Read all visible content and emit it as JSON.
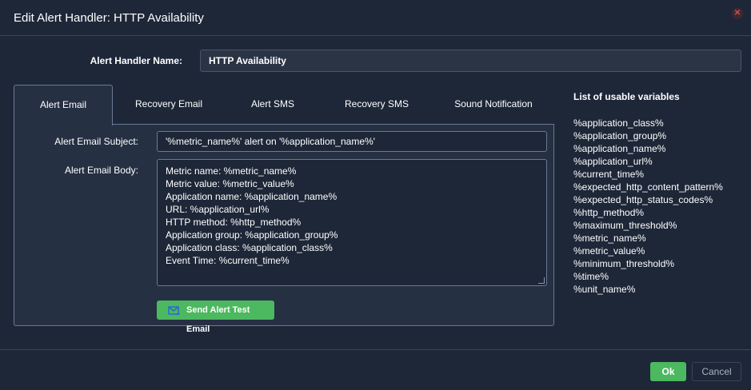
{
  "dialog": {
    "title": "Edit Alert Handler: HTTP Availability",
    "close_icon": "close-icon"
  },
  "handler_name": {
    "label": "Alert Handler Name:",
    "value": "HTTP Availability"
  },
  "tabs": [
    {
      "label": "Alert Email",
      "active": true
    },
    {
      "label": "Recovery Email",
      "active": false
    },
    {
      "label": "Alert SMS",
      "active": false
    },
    {
      "label": "Recovery SMS",
      "active": false
    },
    {
      "label": "Sound Notification",
      "active": false
    }
  ],
  "alert_email": {
    "subject_label": "Alert Email Subject:",
    "subject_value": "'%metric_name%' alert on '%application_name%'",
    "body_label": "Alert Email Body:",
    "body_lines": [
      "Metric name: %metric_name%",
      "Metric value: %metric_value%",
      "Application name: %application_name%",
      "URL: %application_url%",
      "HTTP method: %http_method%",
      "Application group: %application_group%",
      "Application class: %application_class%",
      "Event Time: %current_time%"
    ],
    "test_button": "Send Alert Test Email",
    "test_button_icon": "mail-icon"
  },
  "variables": {
    "title": "List of usable variables",
    "items": [
      "%application_class%",
      "%application_group%",
      "%application_name%",
      "%application_url%",
      "%current_time%",
      "%expected_http_content_pattern%",
      "%expected_http_status_codes%",
      "%http_method%",
      "%maximum_threshold%",
      "%metric_name%",
      "%metric_value%",
      "%minimum_threshold%",
      "%time%",
      "%unit_name%"
    ]
  },
  "footer": {
    "ok_label": "Ok",
    "cancel_label": "Cancel"
  },
  "colors": {
    "background": "#1e2738",
    "panel": "#263043",
    "accent_green": "#4cb860",
    "close_red": "#e04a4a"
  }
}
